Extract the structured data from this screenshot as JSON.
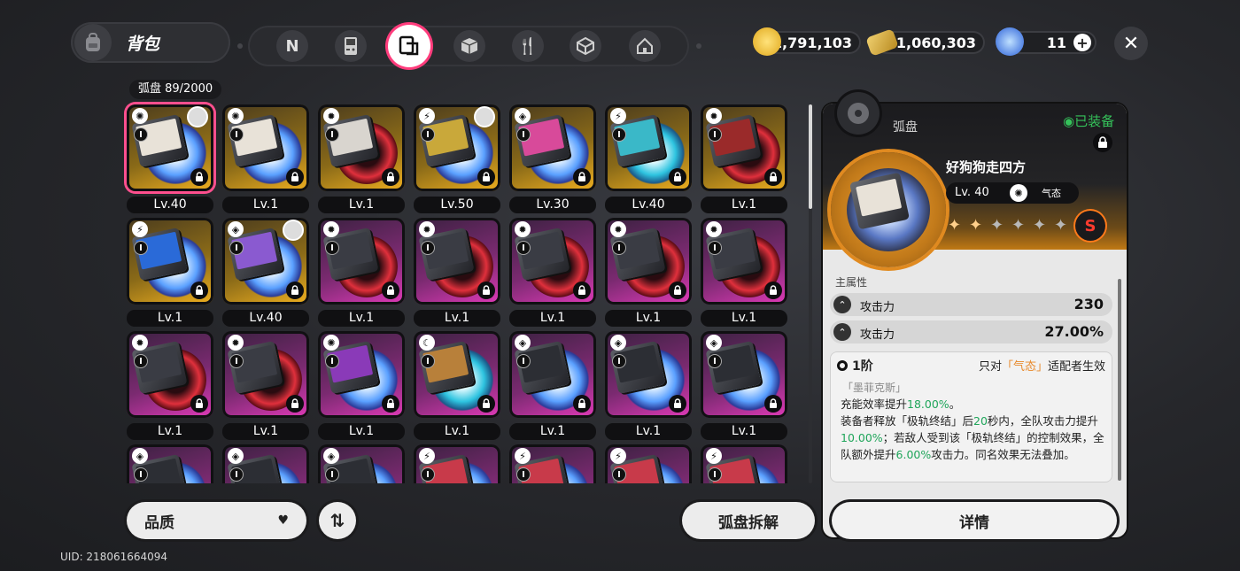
{
  "header": {
    "title": "背包",
    "tabs": [
      {
        "icon": "n-logo-icon"
      },
      {
        "icon": "gameboy-icon"
      },
      {
        "icon": "disc-sleeve-icon",
        "active": true
      },
      {
        "icon": "cube-icon"
      },
      {
        "icon": "fork-knife-icon"
      },
      {
        "icon": "box-3d-icon"
      },
      {
        "icon": "house-icon"
      }
    ],
    "currencies": [
      {
        "icon": "gold-coin-icon",
        "value": "1,791,103",
        "color": "#f2c230"
      },
      {
        "icon": "ticket-icon",
        "value": "1,060,303",
        "color": "#e0b23a"
      },
      {
        "icon": "blue-gem-icon",
        "value": "11",
        "color": "#3a7ae8"
      }
    ],
    "plus": "+",
    "close": "✕"
  },
  "inventory": {
    "count_label": "弧盘  89/2000",
    "items": [
      {
        "level": "Lv.40",
        "frame": "gold",
        "ring": "blue",
        "attr": "✺",
        "selected": true,
        "avatar": true,
        "art": "#e8e2d8"
      },
      {
        "level": "Lv.1",
        "frame": "gold",
        "ring": "blue",
        "attr": "✺",
        "art": "#e8e2d8"
      },
      {
        "level": "Lv.1",
        "frame": "gold",
        "ring": "red",
        "attr": "✹",
        "art": "#d9d5cf"
      },
      {
        "level": "Lv.50",
        "frame": "gold",
        "ring": "blue",
        "attr": "⚡",
        "avatar": true,
        "art": "#c9a83a"
      },
      {
        "level": "Lv.30",
        "frame": "gold",
        "ring": "blue",
        "attr": "◈",
        "art": "#d84a9a"
      },
      {
        "level": "Lv.40",
        "frame": "gold",
        "ring": "teal",
        "attr": "⚡",
        "art": "#3ab8c8"
      },
      {
        "level": "Lv.1",
        "frame": "gold",
        "ring": "red",
        "attr": "✹",
        "art": "#9a2a2a"
      },
      {
        "level": "Lv.1",
        "frame": "gold",
        "ring": "blue",
        "attr": "⚡",
        "art": "#2a6ad8"
      },
      {
        "level": "Lv.40",
        "frame": "gold",
        "ring": "blue",
        "attr": "◈",
        "avatar": true,
        "art": "#8a5ad0"
      },
      {
        "level": "Lv.1",
        "frame": "purple",
        "ring": "red",
        "attr": "✹",
        "art": "#3a3c44"
      },
      {
        "level": "Lv.1",
        "frame": "purple",
        "ring": "red",
        "attr": "✹",
        "art": "#3a3c44"
      },
      {
        "level": "Lv.1",
        "frame": "purple",
        "ring": "red",
        "attr": "✹",
        "art": "#3a3c44"
      },
      {
        "level": "Lv.1",
        "frame": "purple",
        "ring": "red",
        "attr": "✹",
        "art": "#3a3c44"
      },
      {
        "level": "Lv.1",
        "frame": "purple",
        "ring": "red",
        "attr": "✹",
        "art": "#3a3c44"
      },
      {
        "level": "Lv.1",
        "frame": "purple",
        "ring": "red",
        "attr": "✹",
        "art": "#3a3c44"
      },
      {
        "level": "Lv.1",
        "frame": "purple",
        "ring": "red",
        "attr": "✹",
        "art": "#3a3c44"
      },
      {
        "level": "Lv.1",
        "frame": "purple",
        "ring": "blue",
        "attr": "✺",
        "art": "#8a3ab8"
      },
      {
        "level": "Lv.1",
        "frame": "purple",
        "ring": "teal",
        "attr": "☾",
        "art": "#b8803a"
      },
      {
        "level": "Lv.1",
        "frame": "purple",
        "ring": "blue",
        "attr": "◈",
        "art": "#2c2e34"
      },
      {
        "level": "Lv.1",
        "frame": "purple",
        "ring": "blue",
        "attr": "◈",
        "art": "#2c2e34"
      },
      {
        "level": "Lv.1",
        "frame": "purple",
        "ring": "blue",
        "attr": "◈",
        "art": "#2c2e34"
      },
      {
        "level": "",
        "frame": "purple",
        "ring": "blue",
        "attr": "◈",
        "art": "#2c2e34"
      },
      {
        "level": "",
        "frame": "purple",
        "ring": "blue",
        "attr": "◈",
        "art": "#2c2e34"
      },
      {
        "level": "",
        "frame": "purple",
        "ring": "blue",
        "attr": "◈",
        "art": "#2c2e34"
      },
      {
        "level": "",
        "frame": "purple",
        "ring": "blue",
        "attr": "⚡",
        "art": "#c83a4a"
      },
      {
        "level": "",
        "frame": "purple",
        "ring": "blue",
        "attr": "⚡",
        "art": "#c83a4a"
      },
      {
        "level": "",
        "frame": "purple",
        "ring": "blue",
        "attr": "⚡",
        "art": "#c83a4a"
      },
      {
        "level": "",
        "frame": "purple",
        "ring": "blue",
        "attr": "⚡",
        "art": "#c83a4a"
      }
    ]
  },
  "toolbar": {
    "quality_label": "品质",
    "quality_arrow": "♥",
    "sort_label": "⇅",
    "dismantle_label": "弧盘拆解"
  },
  "uid": "UID: 218061664094",
  "detail": {
    "category": "弧盘",
    "equipped": "◉已装备",
    "name": "好狗狗走四方",
    "level": "Lv. 40",
    "attribute": "气态",
    "stars_filled": 2,
    "stars_total": 7,
    "rank_badge": "S",
    "main_stat_title": "主属性",
    "stats": [
      {
        "name": "攻击力",
        "value": "230"
      },
      {
        "name": "攻击力",
        "value": "27.00%"
      }
    ],
    "skill": {
      "tier": "1阶",
      "only_prefix": "只对",
      "only_attr": "「气态」",
      "only_suffix": "适配者生效",
      "name": "「墨菲克斯」",
      "desc_1a": "充能效率提升",
      "desc_1b": "18.00%",
      "desc_1c": "。",
      "desc_2a": "装备者释放「极轨终结」后",
      "desc_2b": "20",
      "desc_2c": "秒内，全队攻击力提升",
      "desc_2d": "10.00%",
      "desc_2e": "；若敌人受到该「极轨终结」的控制效果，全队额外提升",
      "desc_2f": "6.00%",
      "desc_2g": "攻击力。同名效果无法叠加。"
    },
    "details_label": "详情"
  }
}
